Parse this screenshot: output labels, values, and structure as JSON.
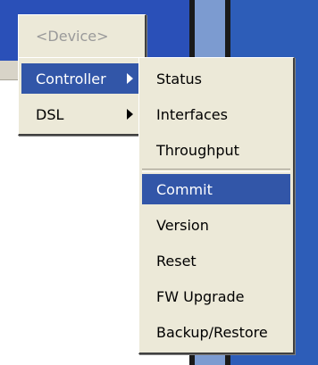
{
  "device_menu": {
    "header_label": "<Device>",
    "items": [
      {
        "label": "Controller",
        "has_submenu": true,
        "selected": true
      },
      {
        "label": "DSL",
        "has_submenu": true,
        "selected": false
      }
    ]
  },
  "controller_submenu": {
    "items": [
      {
        "label": "Status"
      },
      {
        "label": "Interfaces"
      },
      {
        "label": "Throughput"
      },
      {
        "label": "Commit",
        "selected": true
      },
      {
        "label": "Version"
      },
      {
        "label": "Reset"
      },
      {
        "label": "FW Upgrade"
      },
      {
        "label": "Backup/Restore"
      }
    ]
  },
  "colors": {
    "selection": "#3256a8",
    "menu_background": "#ece9d8",
    "titlebar": "#2a50b8"
  }
}
